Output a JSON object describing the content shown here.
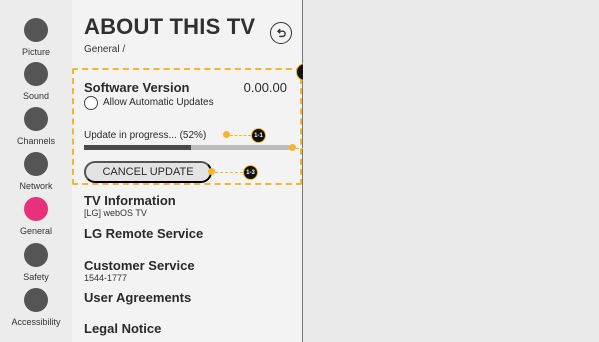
{
  "categories": [
    {
      "label": "Picture",
      "icon": "picture-icon",
      "active": false
    },
    {
      "label": "Sound",
      "icon": "sound-icon",
      "active": false
    },
    {
      "label": "Channels",
      "icon": "channels-icon",
      "active": false
    },
    {
      "label": "Network",
      "icon": "network-icon",
      "active": false
    },
    {
      "label": "General",
      "icon": "general-icon",
      "active": true
    },
    {
      "label": "Safety",
      "icon": "safety-icon",
      "active": false
    },
    {
      "label": "Accessibility",
      "icon": "accessibility-icon",
      "active": false
    }
  ],
  "panel": {
    "title": "ABOUT THIS TV",
    "breadcrumb": "General /",
    "back_icon": "back-icon",
    "software": {
      "label": "Software Version",
      "version": "0.00.00",
      "auto_update_label": "Allow Automatic Updates",
      "auto_update_checked": false
    },
    "update": {
      "status_label": "Update in progress... (52%)",
      "progress_percent": 52,
      "cancel_label": "CANCEL UPDATE"
    },
    "items": [
      {
        "title": "TV Information",
        "subtitle": "[LG] webOS TV"
      },
      {
        "title": "LG Remote Service",
        "subtitle": ""
      },
      {
        "title": "Customer Service",
        "subtitle": "1544-1777"
      },
      {
        "title": "User Agreements",
        "subtitle": ""
      },
      {
        "title": "Legal Notice",
        "subtitle": ""
      }
    ]
  },
  "callouts": {
    "main": "1",
    "progress_text": "1-1",
    "progress_bar": "1-2",
    "cancel": "1-3"
  },
  "colors": {
    "accent": "#e8317a",
    "callout": "#f3b62d",
    "rail_bg": "#ececec",
    "panel_bg": "#f3f3f3",
    "viewer_bg": "#eaeaea"
  }
}
